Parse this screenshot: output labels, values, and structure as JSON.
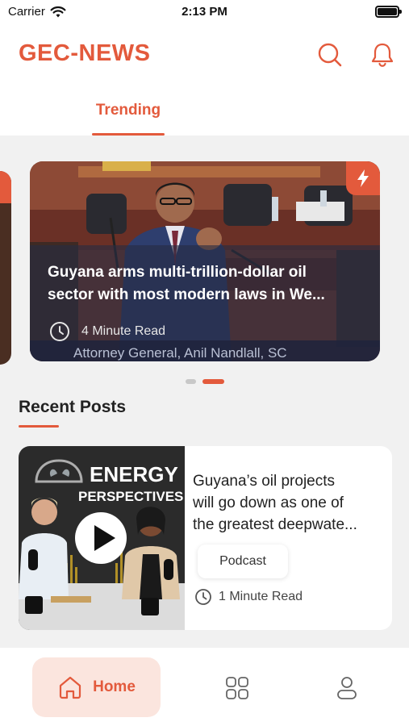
{
  "status_bar": {
    "carrier": "Carrier",
    "time": "2:13 PM"
  },
  "header": {
    "title": "GEC-NEWS",
    "tabs": [
      {
        "label": "Trending",
        "active": true
      }
    ]
  },
  "featured": {
    "title_line1": "Guyana arms multi-trillion-dollar oil",
    "title_line2": "sector with most modern laws in We...",
    "read_time": "4  Minute Read",
    "image_caption": "Attorney General, Anil Nandlall, SC",
    "slide_count": 2,
    "active_slide": 2
  },
  "recent_posts": {
    "section_title": "Recent Posts",
    "items": [
      {
        "title_line1": "Guyana’s oil projects",
        "title_line2": "will go down as one of",
        "title_line3": "the greatest deepwate...",
        "tag": "Podcast",
        "read_time": "1 Minute Read",
        "thumbnail_text_line1": "ENERGY",
        "thumbnail_text_line2": "PERSPECTIVES"
      }
    ]
  },
  "bottom_nav": {
    "home_label": "Home"
  },
  "colors": {
    "accent": "#e35a3c",
    "accent_soft": "#fbe5de",
    "background": "#f1f1f1"
  }
}
